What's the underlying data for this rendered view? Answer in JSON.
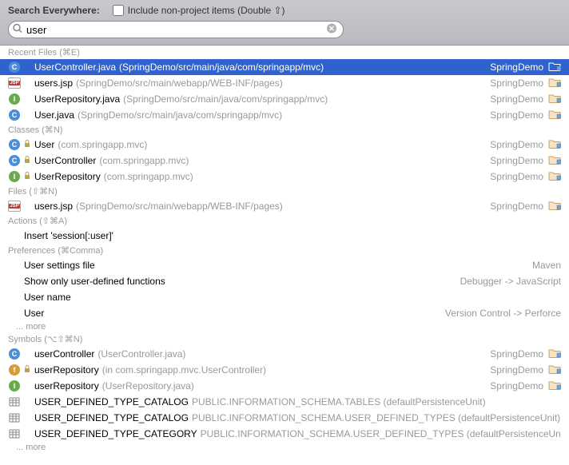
{
  "header": {
    "title": "Search Everywhere:",
    "checkbox_label": "Include non-project items (Double ⇧)",
    "search_value": "user"
  },
  "sections": {
    "recent_files": {
      "label": "Recent Files (⌘E)"
    },
    "classes": {
      "label": "Classes (⌘N)"
    },
    "files": {
      "label": "Files (⇧⌘N)"
    },
    "actions": {
      "label": "Actions (⇧⌘A)"
    },
    "preferences": {
      "label": "Preferences (⌘Comma)"
    },
    "symbols": {
      "label": "Symbols (⌥⇧⌘N)"
    }
  },
  "recent_files": [
    {
      "name": "UserController.java",
      "hint": "(SpringDemo/src/main/java/com/springapp/mvc)",
      "right": "SpringDemo",
      "icon": "class-c"
    },
    {
      "name": "users.jsp",
      "hint": "(SpringDemo/src/main/webapp/WEB-INF/pages)",
      "right": "SpringDemo",
      "icon": "jsp"
    },
    {
      "name": "UserRepository.java",
      "hint": "(SpringDemo/src/main/java/com/springapp/mvc)",
      "right": "SpringDemo",
      "icon": "interface-i"
    },
    {
      "name": "User.java",
      "hint": "(SpringDemo/src/main/java/com/springapp/mvc)",
      "right": "SpringDemo",
      "icon": "class-c"
    }
  ],
  "classes": [
    {
      "name": "User",
      "hint": "(com.springapp.mvc)",
      "right": "SpringDemo",
      "icon": "class-c",
      "lock": true
    },
    {
      "name": "UserController",
      "hint": "(com.springapp.mvc)",
      "right": "SpringDemo",
      "icon": "class-c",
      "lock": true
    },
    {
      "name": "UserRepository",
      "hint": "(com.springapp.mvc)",
      "right": "SpringDemo",
      "icon": "interface-i",
      "lock": true
    }
  ],
  "files": [
    {
      "name": "users.jsp",
      "hint": "(SpringDemo/src/main/webapp/WEB-INF/pages)",
      "right": "SpringDemo",
      "icon": "jsp"
    }
  ],
  "actions": [
    {
      "name": "Insert 'session[:user]'"
    }
  ],
  "preferences": [
    {
      "name": "User settings file",
      "right": "Maven"
    },
    {
      "name": "Show only user-defined functions",
      "right": "Debugger -> JavaScript"
    },
    {
      "name": "User name",
      "right": ""
    },
    {
      "name": "User",
      "right": "Version Control -> Perforce"
    }
  ],
  "symbols": [
    {
      "name": "userController",
      "hint": "(UserController.java)",
      "right": "SpringDemo",
      "icon": "class-c",
      "folder": true
    },
    {
      "name": "userRepository",
      "hint": "(in com.springapp.mvc.UserController)",
      "right": "SpringDemo",
      "icon": "field-f",
      "lock": true,
      "folder": true
    },
    {
      "name": "userRepository",
      "hint": "(UserRepository.java)",
      "right": "SpringDemo",
      "icon": "interface-i",
      "folder": true
    },
    {
      "name": "USER_DEFINED_TYPE_CATALOG",
      "hint": "PUBLIC.INFORMATION_SCHEMA.TABLES (defaultPersistenceUnit)",
      "right": "",
      "icon": "table"
    },
    {
      "name": "USER_DEFINED_TYPE_CATALOG",
      "hint": "PUBLIC.INFORMATION_SCHEMA.USER_DEFINED_TYPES (defaultPersistenceUnit)",
      "right": "",
      "icon": "table"
    },
    {
      "name": "USER_DEFINED_TYPE_CATEGORY",
      "hint": "PUBLIC.INFORMATION_SCHEMA.USER_DEFINED_TYPES (defaultPersistenceUnit)",
      "right": "",
      "icon": "table"
    }
  ],
  "more_label": "... more"
}
